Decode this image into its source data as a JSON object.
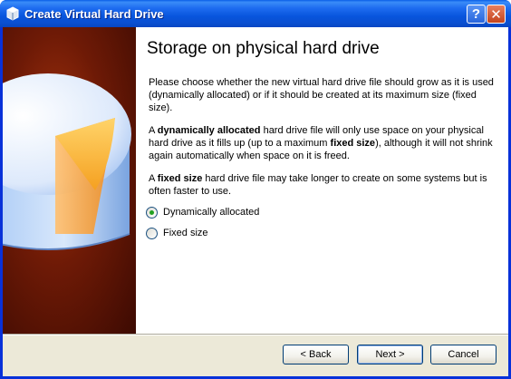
{
  "window": {
    "title": "Create Virtual Hard Drive"
  },
  "titlebar": {
    "help_glyph": "?",
    "close_glyph": "✕"
  },
  "page": {
    "heading": "Storage on physical hard drive",
    "paragraph1": "Please choose whether the new virtual hard drive file should grow as it is used (dynamically allocated) or if it should be created at its maximum size (fixed size).",
    "paragraph2_pre": "A ",
    "paragraph2_bold1": "dynamically allocated",
    "paragraph2_mid": " hard drive file will only use space on your physical hard drive as it fills up (up to a maximum ",
    "paragraph2_bold2": "fixed size",
    "paragraph2_post": "), although it will not shrink again automatically when space on it is freed.",
    "paragraph3_pre": "A ",
    "paragraph3_bold": "fixed size",
    "paragraph3_post": " hard drive file may take longer to create on some systems but is often faster to use."
  },
  "options": [
    {
      "label": "Dynamically allocated",
      "selected": true
    },
    {
      "label": "Fixed size",
      "selected": false
    }
  ],
  "buttons": {
    "back": "< Back",
    "next": "Next >",
    "cancel": "Cancel"
  },
  "icons": {
    "title": "virtualbox-icon",
    "art": "hard-disk-pie-icon"
  },
  "colors": {
    "titlebar": "#0855dd",
    "accent": "#ffb23b",
    "panel": "#6e1a06"
  }
}
